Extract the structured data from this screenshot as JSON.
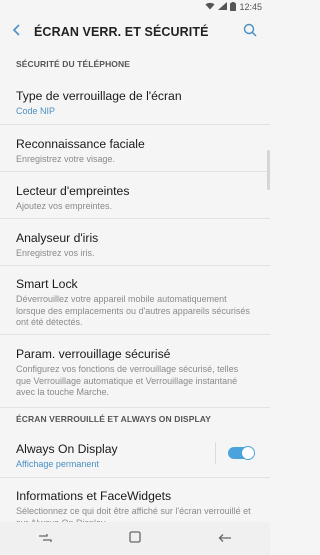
{
  "status_bar": {
    "time": "12:45",
    "icons": [
      "wifi-icon",
      "signal-icon",
      "battery-icon"
    ]
  },
  "header": {
    "title": "ÉCRAN VERR. ET SÉCURITÉ",
    "back_icon": "back-arrow-icon",
    "search_icon": "search-icon"
  },
  "sections": [
    {
      "header": "SÉCURITÉ DU TÉLÉPHONE",
      "items": [
        {
          "title": "Type de verrouillage de l'écran",
          "subtitle": "Code NIP"
        },
        {
          "title": "Reconnaissance faciale",
          "subtitle": "Enregistrez votre visage."
        },
        {
          "title": "Lecteur d'empreintes",
          "subtitle": "Ajoutez vos empreintes."
        },
        {
          "title": "Analyseur d'iris",
          "subtitle": "Enregistrez vos iris."
        },
        {
          "title": "Smart Lock",
          "subtitle": "Déverrouillez votre appareil mobile automatiquement lorsque des emplacements ou d'autres appareils sécurisés ont été détectés."
        },
        {
          "title": "Param. verrouillage sécurisé",
          "subtitle": "Configurez vos fonctions de verrouillage sécurisé, telles que Verrouillage automatique et Verrouillage instantané avec la touche Marche."
        }
      ]
    },
    {
      "header": "ÉCRAN VERROUILLÉ ET ALWAYS ON DISPLAY",
      "items": [
        {
          "title": "Always On Display",
          "subtitle": "Affichage permanent",
          "toggle": true
        },
        {
          "title": "Informations et FaceWidgets",
          "subtitle": "Sélectionnez ce qui doit être affiché sur l'écran verrouillé et sur Always On Display."
        }
      ]
    }
  ],
  "colors": {
    "accent": "#4a8fc3",
    "toggle_on": "#4aa3dc"
  },
  "nav_bar": {
    "icons": [
      "recent-apps-icon",
      "home-icon",
      "back-nav-icon"
    ]
  }
}
